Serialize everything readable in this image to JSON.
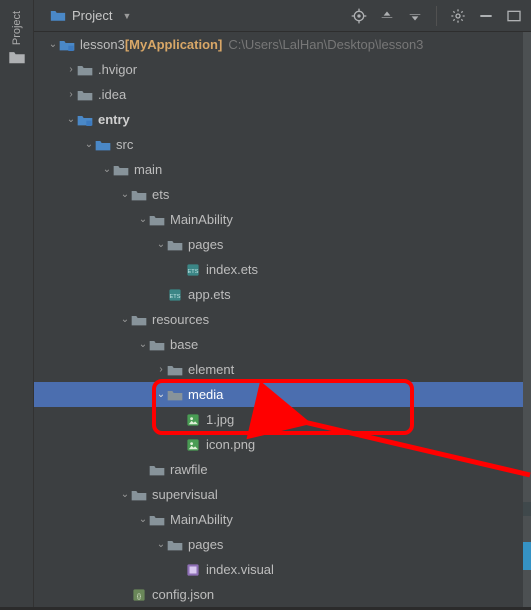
{
  "panel": {
    "title": "Project",
    "side_label": "Project"
  },
  "toolbar": {
    "target_icon": "target",
    "expand_icon": "expand-all",
    "collapse_icon": "collapse-all",
    "settings_icon": "gear",
    "minimize_icon": "minimize"
  },
  "colors": {
    "selection": "#4b6eaf",
    "accent_module": "#d9a767",
    "highlight_border": "#ff0000"
  },
  "tree": [
    {
      "depth": 0,
      "arrow": "v",
      "icon": "folder-module",
      "label": "lesson3",
      "bracket": "[MyApplication]",
      "path": "C:\\Users\\LalHan\\Desktop\\lesson3",
      "selected": false
    },
    {
      "depth": 1,
      "arrow": ">",
      "icon": "folder",
      "label": ".hvigor"
    },
    {
      "depth": 1,
      "arrow": ">",
      "icon": "folder",
      "label": ".idea"
    },
    {
      "depth": 1,
      "arrow": "v",
      "icon": "folder-module",
      "label": "entry",
      "bold": true
    },
    {
      "depth": 2,
      "arrow": "v",
      "icon": "folder-src",
      "label": "src"
    },
    {
      "depth": 3,
      "arrow": "v",
      "icon": "folder",
      "label": "main"
    },
    {
      "depth": 4,
      "arrow": "v",
      "icon": "folder",
      "label": "ets"
    },
    {
      "depth": 5,
      "arrow": "v",
      "icon": "folder",
      "label": "MainAbility"
    },
    {
      "depth": 6,
      "arrow": "v",
      "icon": "folder",
      "label": "pages"
    },
    {
      "depth": 7,
      "arrow": "",
      "icon": "file-ets",
      "label": "index.ets"
    },
    {
      "depth": 6,
      "arrow": "",
      "icon": "file-ets",
      "label": "app.ets"
    },
    {
      "depth": 4,
      "arrow": "v",
      "icon": "folder",
      "label": "resources"
    },
    {
      "depth": 5,
      "arrow": "v",
      "icon": "folder",
      "label": "base"
    },
    {
      "depth": 6,
      "arrow": ">",
      "icon": "folder",
      "label": "element"
    },
    {
      "depth": 6,
      "arrow": "v",
      "icon": "folder",
      "label": "media",
      "selected": true
    },
    {
      "depth": 7,
      "arrow": "",
      "icon": "file-img",
      "label": "1.jpg"
    },
    {
      "depth": 7,
      "arrow": "",
      "icon": "file-img",
      "label": "icon.png"
    },
    {
      "depth": 5,
      "arrow": "",
      "icon": "folder",
      "label": "rawfile"
    },
    {
      "depth": 4,
      "arrow": "v",
      "icon": "folder",
      "label": "supervisual"
    },
    {
      "depth": 5,
      "arrow": "v",
      "icon": "folder",
      "label": "MainAbility"
    },
    {
      "depth": 6,
      "arrow": "v",
      "icon": "folder",
      "label": "pages"
    },
    {
      "depth": 7,
      "arrow": "",
      "icon": "file-vis",
      "label": "index.visual"
    },
    {
      "depth": 4,
      "arrow": "",
      "icon": "file-json",
      "label": "config.json"
    }
  ],
  "highlight": {
    "rows": [
      14,
      15
    ],
    "arrow_from": "outside-right",
    "arrow_to_row": 15
  }
}
